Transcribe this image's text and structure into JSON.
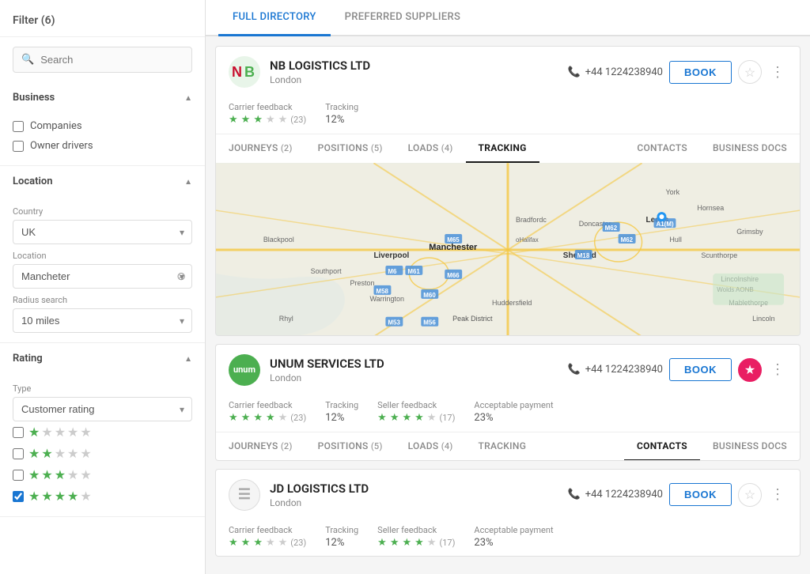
{
  "sidebar": {
    "filter_title": "Filter (6)",
    "search": {
      "placeholder": "Search"
    },
    "business": {
      "label": "Business",
      "items": [
        {
          "label": "Companies",
          "checked": false
        },
        {
          "label": "Owner drivers",
          "checked": false
        }
      ]
    },
    "location": {
      "label": "Location",
      "country_label": "Country",
      "country_value": "UK",
      "location_label": "Location",
      "location_value": "Mancheter",
      "radius_label": "Radius search",
      "radius_value": "10 miles"
    },
    "rating": {
      "label": "Rating",
      "type_label": "Type",
      "type_value": "Customer rating",
      "stars": [
        {
          "filled": 1,
          "empty": 4,
          "checked": false
        },
        {
          "filled": 2,
          "empty": 3,
          "checked": false
        },
        {
          "filled": 3,
          "empty": 2,
          "checked": false
        },
        {
          "filled": 4,
          "empty": 1,
          "checked": true
        }
      ]
    }
  },
  "tabs": [
    {
      "label": "FULL DIRECTORY",
      "active": true
    },
    {
      "label": "PREFERRED SUPPLIERS",
      "active": false
    }
  ],
  "suppliers": [
    {
      "id": "nb-logistics",
      "name": "NB LOGISTICS LTD",
      "city": "London",
      "logo_type": "nb",
      "logo_text": "",
      "phone": "+44 1224238940",
      "book_label": "BOOK",
      "starred": false,
      "carrier_feedback_label": "Carrier feedback",
      "carrier_feedback_filled": 3,
      "carrier_feedback_empty": 2,
      "carrier_feedback_count": "(23)",
      "tracking_label": "Tracking",
      "tracking_value": "12%",
      "active_nav": "TRACKING",
      "nav_items": [
        {
          "label": "JOURNEYS",
          "count": "(2)"
        },
        {
          "label": "POSITIONS",
          "count": "(5)"
        },
        {
          "label": "LOADS",
          "count": "(4)"
        },
        {
          "label": "TRACKING",
          "count": ""
        },
        {
          "label": "CONTACTS",
          "count": ""
        },
        {
          "label": "BUSINESS DOCS",
          "count": ""
        }
      ],
      "has_map": true
    },
    {
      "id": "unum-services",
      "name": "UNUM SERVICES LTD",
      "city": "London",
      "logo_type": "unum",
      "logo_text": "unum",
      "phone": "+44 1224238940",
      "book_label": "BOOK",
      "starred": true,
      "carrier_feedback_label": "Carrier feedback",
      "carrier_feedback_filled": 4,
      "carrier_feedback_empty": 1,
      "carrier_feedback_count": "(23)",
      "tracking_label": "Tracking",
      "tracking_value": "12%",
      "seller_feedback_label": "Seller feedback",
      "seller_feedback_filled": 4,
      "seller_feedback_empty": 1,
      "seller_feedback_count": "(17)",
      "acceptable_payment_label": "Acceptable payment",
      "acceptable_payment_value": "23%",
      "active_nav": "CONTACTS",
      "nav_items": [
        {
          "label": "JOURNEYS",
          "count": "(2)"
        },
        {
          "label": "POSITIONS",
          "count": "(5)"
        },
        {
          "label": "LOADS",
          "count": "(4)"
        },
        {
          "label": "TRACKING",
          "count": ""
        },
        {
          "label": "CONTACTS",
          "count": ""
        },
        {
          "label": "BUSINESS DOCS",
          "count": ""
        }
      ],
      "has_map": false
    },
    {
      "id": "jd-logistics",
      "name": "JD LOGISTICS LTD",
      "city": "London",
      "logo_type": "jd",
      "logo_text": "≡",
      "phone": "+44 1224238940",
      "book_label": "BOOK",
      "starred": false,
      "carrier_feedback_label": "Carrier feedback",
      "carrier_feedback_filled": 3,
      "carrier_feedback_empty": 2,
      "carrier_feedback_count": "(23)",
      "tracking_label": "Tracking",
      "tracking_value": "12%",
      "seller_feedback_label": "Seller feedback",
      "seller_feedback_filled": 4,
      "seller_feedback_empty": 1,
      "seller_feedback_count": "(17)",
      "acceptable_payment_label": "Acceptable payment",
      "acceptable_payment_value": "23%",
      "has_map": false
    }
  ],
  "icons": {
    "search": "🔍",
    "phone": "📞",
    "more": "⋮",
    "star_empty": "☆",
    "star_filled": "★"
  }
}
